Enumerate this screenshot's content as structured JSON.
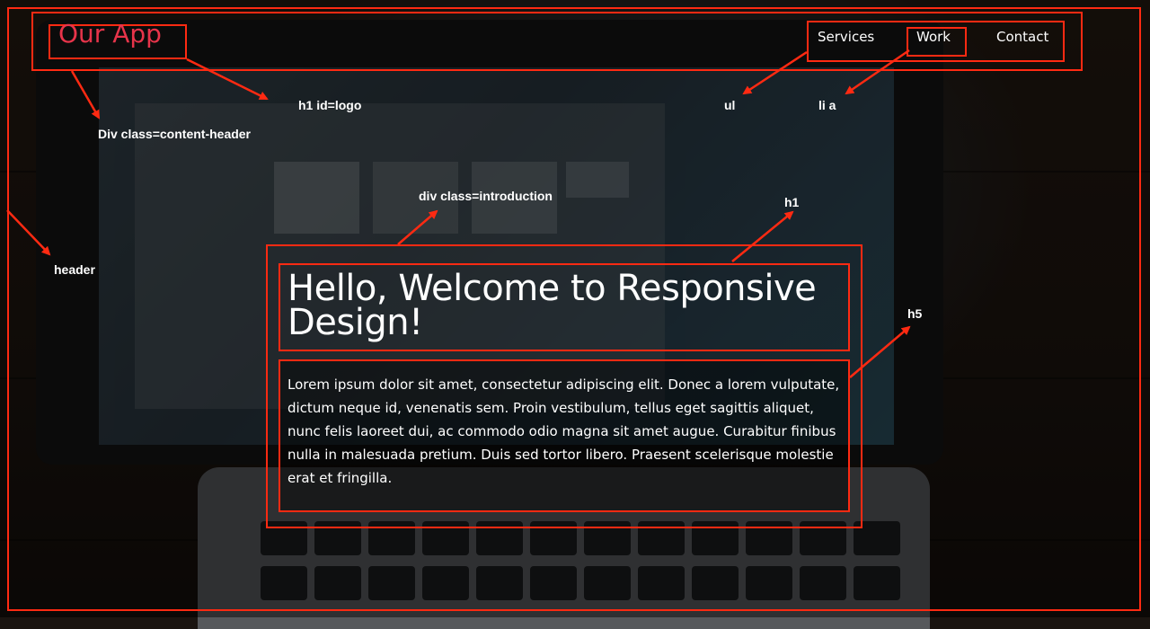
{
  "header": {
    "logo": "Our App",
    "nav": [
      {
        "label": "Services"
      },
      {
        "label": "Work"
      },
      {
        "label": "Contact"
      }
    ]
  },
  "introduction": {
    "title": "Hello, Welcome to Responsive Design!",
    "text": "Lorem ipsum dolor sit amet, consectetur adipiscing elit. Donec a lorem vulputate, dictum neque id, venenatis sem. Proin vestibulum, tellus eget sagittis aliquet, nunc felis laoreet dui, ac commodo odio magna sit amet augue. Curabitur finibus nulla in malesuada pretium. Duis sed tortor libero. Praesent scelerisque molestie erat et fringilla."
  },
  "annotations": {
    "logo": "h1 id=logo",
    "content_header": "Div class=content-header",
    "ul": "ul",
    "li_a": "li a",
    "introduction": "div class=introduction",
    "h1": "h1",
    "h5": "h5",
    "header": "header"
  },
  "colors": {
    "annotation": "#ff2a12",
    "logo": "#e7344a",
    "text": "#ffffff"
  }
}
